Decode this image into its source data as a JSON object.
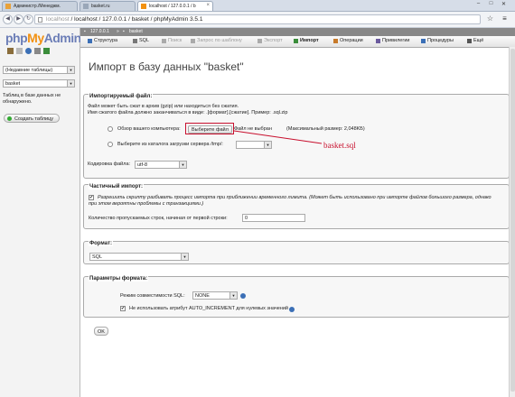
{
  "browser": {
    "tabs": [
      {
        "label": "Администр./Менеджм.",
        "active": false
      },
      {
        "label": "basket.ru",
        "active": false
      },
      {
        "label": "localhost / 127.0.0.1 / b",
        "active": true
      }
    ],
    "url_host": "localhost",
    "url_rest": "localhost / 127.0.0.1 / basket / phpMyAdmin 3.5.1",
    "back_glyph": "◀",
    "forward_glyph": "▶",
    "reload_glyph": "↻",
    "star_glyph": "☆",
    "menu_glyph": "≡",
    "min_glyph": "–",
    "max_glyph": "□",
    "close_glyph": "✕"
  },
  "sidebar": {
    "logo_php": "php",
    "logo_my": "My",
    "logo_admin": "Admin",
    "recent_select": "(Недавние таблицы)",
    "db_select": "basket",
    "no_tables_msg": "Таблиц в базе данных не обнаружено.",
    "create_table_label": "Создать таблицу"
  },
  "breadcrumb": {
    "server": "127.0.0.1",
    "database": "basket"
  },
  "topnav": [
    {
      "label": "Структура",
      "icon": "structure-icon",
      "dim": false,
      "active": false,
      "color": "#3b6fb6"
    },
    {
      "label": "SQL",
      "icon": "sql-icon",
      "dim": false,
      "active": false,
      "color": "#777"
    },
    {
      "label": "Поиск",
      "icon": "search-icon",
      "dim": true,
      "active": false,
      "color": "#aaa"
    },
    {
      "label": "Запрос по шаблону",
      "icon": "query-icon",
      "dim": true,
      "active": false,
      "color": "#aaa"
    },
    {
      "label": "Экспорт",
      "icon": "export-icon",
      "dim": true,
      "active": false,
      "color": "#aaa"
    },
    {
      "label": "Импорт",
      "icon": "import-icon",
      "dim": false,
      "active": true,
      "color": "#3a8d3a"
    },
    {
      "label": "Операции",
      "icon": "operations-icon",
      "dim": false,
      "active": false,
      "color": "#c77a2a"
    },
    {
      "label": "Привилегии",
      "icon": "privileges-icon",
      "dim": false,
      "active": false,
      "color": "#6b5a9e"
    },
    {
      "label": "Процедуры",
      "icon": "routines-icon",
      "dim": false,
      "active": false,
      "color": "#3b6fb6"
    },
    {
      "label": "Ещё",
      "icon": "more-icon",
      "dim": false,
      "active": false,
      "color": "#555"
    }
  ],
  "page_title": "Импорт в базу данных \"basket\"",
  "import_file": {
    "legend": "Импортируемый файл:",
    "note1": "Файл может быть сжат в архив (gzip) или находиться без сжатия.",
    "note2": "Имя сжатого файла должно заканчиваться в виде: .[формат].[сжатие]. Пример: .sql.zip",
    "option_browse": "Обзор вашего компьютера:",
    "choose_file_btn": "Выберите файл",
    "no_file": "Файл не выбран",
    "max_size": "(Максимальный размер: 2,048KБ)",
    "option_server": "Выберите из каталога загрузки сервера /tmp/:",
    "charset_label": "Кодировка файла:",
    "charset_value": "utf-8"
  },
  "annotation": "basket.sql",
  "partial_import": {
    "legend": "Частичный импорт:",
    "allow_interrupt": "Разрешить скрипту разбивать процесс импорта при приближении временного лимита. (Может быть использовано при импорте файлов большого размера, однако",
    "allow_interrupt_2": "при этом вероятны проблемы с транзакциями.)",
    "skip_label": "Количество пропускаемых строк, начиная от первой строки:",
    "skip_value": "0"
  },
  "format": {
    "legend": "Формат:",
    "value": "SQL"
  },
  "format_options": {
    "legend": "Параметры формата:",
    "compat_label": "Режим совместимости SQL:",
    "compat_value": "NONE",
    "no_auto_value": "Не использовать атрибут AUTO_INCREMENT для нулевых значений"
  },
  "ok_label": "OK"
}
